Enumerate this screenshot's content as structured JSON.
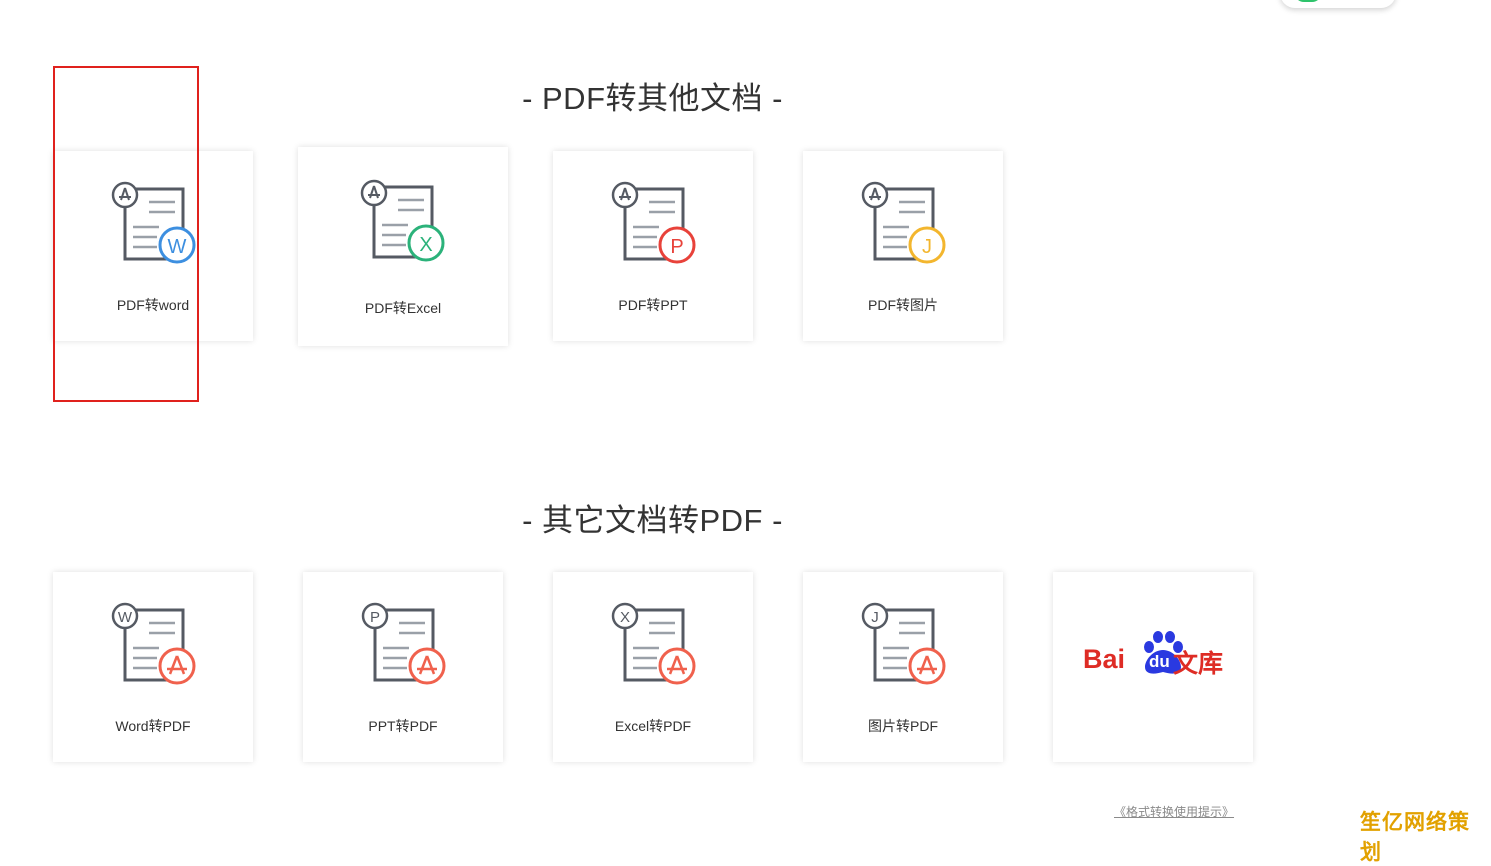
{
  "section_pdf_to_other": {
    "title": "- PDF转其他文档 -",
    "cards": [
      {
        "label": "PDF转word",
        "badge_letter": "W",
        "badge_color": "#3d8fe0"
      },
      {
        "label": "PDF转Excel",
        "badge_letter": "X",
        "badge_color": "#2bb27a"
      },
      {
        "label": "PDF转PPT",
        "badge_letter": "P",
        "badge_color": "#e8423a"
      },
      {
        "label": "PDF转图片",
        "badge_letter": "J",
        "badge_color": "#f3b62e"
      }
    ]
  },
  "section_other_to_pdf": {
    "title": "- 其它文档转PDF -",
    "cards": [
      {
        "label": "Word转PDF",
        "top_letter": "W"
      },
      {
        "label": "PPT转PDF",
        "top_letter": "P"
      },
      {
        "label": "Excel转PDF",
        "top_letter": "X"
      },
      {
        "label": "图片转PDF",
        "top_letter": "J"
      }
    ],
    "partner": {
      "brand_left": "Bai",
      "brand_mid": "du",
      "brand_right": "文库"
    }
  },
  "footer": {
    "link": "《格式转换使用提示》"
  },
  "watermark": "笙亿网络策划",
  "colors": {
    "pdf_badge": "#f0614d",
    "doc_line": "#555a63",
    "highlight": "#e0211d",
    "baidu_red": "#de2c25",
    "baidu_blue": "#2a39e0"
  },
  "icons": {
    "pdf_symbol": "acrobat-icon",
    "document": "document-icon"
  }
}
